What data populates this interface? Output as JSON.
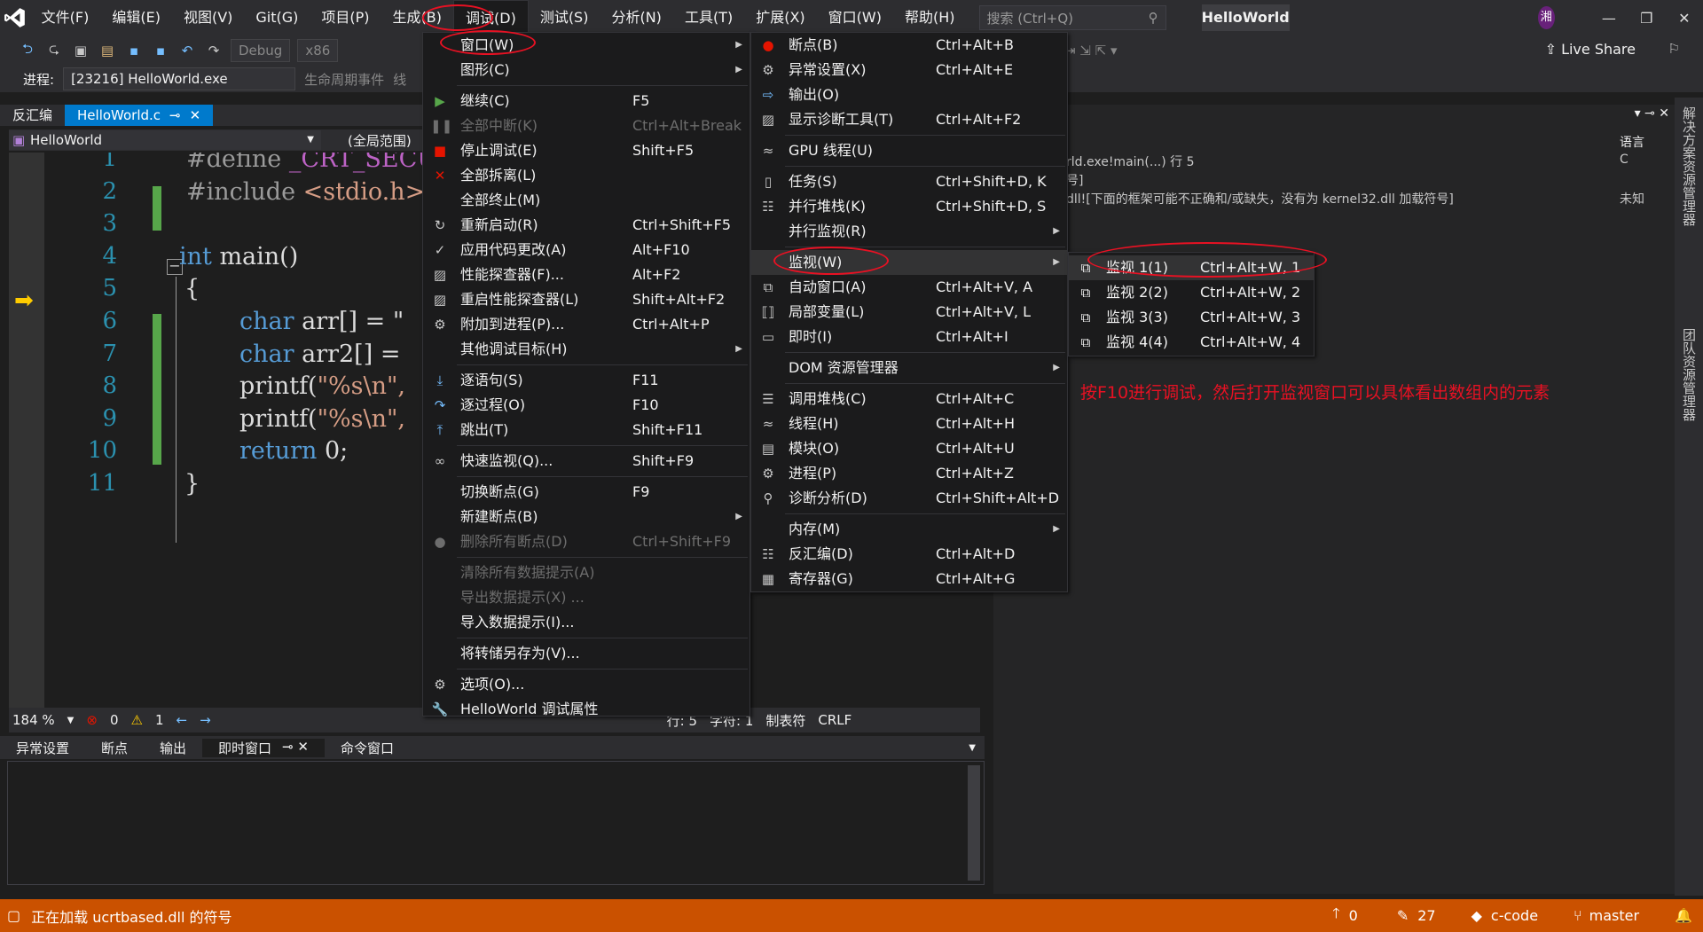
{
  "titlebar": {
    "menus": [
      "文件(F)",
      "编辑(E)",
      "视图(V)",
      "Git(G)",
      "项目(P)",
      "生成(B)",
      "调试(D)",
      "测试(S)",
      "分析(N)",
      "工具(T)",
      "扩展(X)",
      "窗口(W)",
      "帮助(H)"
    ],
    "search_placeholder": "搜索 (Ctrl+Q)",
    "app_title": "HelloWorld",
    "avatar": "湘"
  },
  "toolbar": {
    "config": "Debug",
    "platform": "x86",
    "live_share": "Live Share"
  },
  "procbar": {
    "label": "进程:",
    "process": "[23216] HelloWorld.exe",
    "lifecycle": "生命周期事件",
    "thread_trunc": "线"
  },
  "tabs": {
    "disasm": "反汇编",
    "file": "HelloWorld.c"
  },
  "navbar": {
    "project": "HelloWorld",
    "scope": "(全局范围)"
  },
  "editor": {
    "line_numbers": [
      "1",
      "2",
      "3",
      "4",
      "5",
      "6",
      "7",
      "8",
      "9",
      "10",
      "11"
    ],
    "lines": [
      {
        "a": "#define ",
        "b": "_CRT_SECUR"
      },
      {
        "a": "#include ",
        "b": "<stdio.h>"
      },
      {
        "a": "",
        "b": ""
      },
      {
        "a": "int",
        "b": " main()"
      },
      {
        "a": "{",
        "b": ""
      },
      {
        "a": "char",
        "b": " arr[] = \""
      },
      {
        "a": "char",
        "b": " arr2[] ="
      },
      {
        "a": "printf(",
        "b": "\"%s\\n\","
      },
      {
        "a": "printf(",
        "b": "\"%s\\n\","
      },
      {
        "a": "return",
        "b": " 0;"
      },
      {
        "a": "}",
        "b": ""
      }
    ]
  },
  "edstatus": {
    "zoom": "184 %",
    "errors": "0",
    "warnings": "1",
    "line": "行: 5",
    "col": "字符: 1",
    "tab": "制表符",
    "eol": "CRLF"
  },
  "bottom_tabs": [
    "异常设置",
    "断点",
    "输出",
    "即时窗口",
    "命令窗口"
  ],
  "right_panel": {
    "header_lang": "语言",
    "rows": [
      {
        "text": "rld.exe!main(...) 行 5",
        "lang": "C"
      },
      {
        "text": "号]",
        "lang": ""
      },
      {
        "text": "dll![下面的框架可能不正确和/或缺失，没有为 kernel32.dll 加载符号]",
        "lang": "未知"
      }
    ],
    "side_tabs": [
      "解决方案资源管理器",
      "团队资源管理器"
    ]
  },
  "debug_menu": [
    {
      "label": "窗口(W)",
      "shortcut": "",
      "sub": true,
      "icon": ""
    },
    {
      "label": "图形(C)",
      "shortcut": "",
      "sub": true,
      "icon": ""
    },
    {
      "sep": true
    },
    {
      "label": "继续(C)",
      "shortcut": "F5",
      "icon": "play-icon"
    },
    {
      "label": "全部中断(K)",
      "shortcut": "Ctrl+Alt+Break",
      "dis": true,
      "icon": "pause-icon"
    },
    {
      "label": "停止调试(E)",
      "shortcut": "Shift+F5",
      "icon": "stop-icon"
    },
    {
      "label": "全部拆离(L)",
      "shortcut": "",
      "icon": "x-icon"
    },
    {
      "label": "全部终止(M)",
      "shortcut": "",
      "icon": ""
    },
    {
      "label": "重新启动(R)",
      "shortcut": "Ctrl+Shift+F5",
      "icon": "restart-icon"
    },
    {
      "label": "应用代码更改(A)",
      "shortcut": "Alt+F10",
      "icon": "apply-icon"
    },
    {
      "label": "性能探查器(F)...",
      "shortcut": "Alt+F2",
      "icon": "profiler-icon"
    },
    {
      "label": "重启性能探查器(L)",
      "shortcut": "Shift+Alt+F2",
      "icon": "profiler-icon"
    },
    {
      "label": "附加到进程(P)...",
      "shortcut": "Ctrl+Alt+P",
      "icon": "gear-icon"
    },
    {
      "label": "其他调试目标(H)",
      "shortcut": "",
      "sub": true,
      "icon": ""
    },
    {
      "sep": true
    },
    {
      "label": "逐语句(S)",
      "shortcut": "F11",
      "icon": "step-into-icon"
    },
    {
      "label": "逐过程(O)",
      "shortcut": "F10",
      "icon": "step-over-icon"
    },
    {
      "label": "跳出(T)",
      "shortcut": "Shift+F11",
      "icon": "step-out-icon"
    },
    {
      "sep": true
    },
    {
      "label": "快速监视(Q)...",
      "shortcut": "Shift+F9",
      "icon": "glasses-icon"
    },
    {
      "sep": true
    },
    {
      "label": "切换断点(G)",
      "shortcut": "F9",
      "icon": ""
    },
    {
      "label": "新建断点(B)",
      "shortcut": "",
      "sub": true,
      "icon": ""
    },
    {
      "label": "删除所有断点(D)",
      "shortcut": "Ctrl+Shift+F9",
      "dis": true,
      "icon": "bp-icon"
    },
    {
      "sep": true
    },
    {
      "label": "清除所有数据提示(A)",
      "shortcut": "",
      "dis": true,
      "icon": ""
    },
    {
      "label": "导出数据提示(X) ...",
      "shortcut": "",
      "dis": true,
      "icon": ""
    },
    {
      "label": "导入数据提示(I)...",
      "shortcut": "",
      "icon": ""
    },
    {
      "sep": true
    },
    {
      "label": "将转储另存为(V)...",
      "shortcut": "",
      "icon": ""
    },
    {
      "sep": true
    },
    {
      "label": "选项(O)...",
      "shortcut": "",
      "icon": "gear-icon"
    },
    {
      "label": "HelloWorld 调试属性",
      "shortcut": "",
      "icon": "wrench-icon"
    }
  ],
  "window_menu": [
    {
      "label": "断点(B)",
      "shortcut": "Ctrl+Alt+B",
      "icon": "breakpoint-icon"
    },
    {
      "label": "异常设置(X)",
      "shortcut": "Ctrl+Alt+E",
      "icon": "exception-icon"
    },
    {
      "label": "输出(O)",
      "shortcut": "",
      "icon": "output-icon"
    },
    {
      "label": "显示诊断工具(T)",
      "shortcut": "Ctrl+Alt+F2",
      "icon": "diag-icon"
    },
    {
      "sep": true
    },
    {
      "label": "GPU 线程(U)",
      "shortcut": "",
      "icon": "thread-icon"
    },
    {
      "sep": true
    },
    {
      "label": "任务(S)",
      "shortcut": "Ctrl+Shift+D, K",
      "icon": "task-icon"
    },
    {
      "label": "并行堆栈(K)",
      "shortcut": "Ctrl+Shift+D, S",
      "icon": "stack-icon"
    },
    {
      "label": "并行监视(R)",
      "shortcut": "",
      "sub": true,
      "icon": ""
    },
    {
      "sep": true
    },
    {
      "label": "监视(W)",
      "shortcut": "",
      "sub": true,
      "icon": "",
      "hl": true
    },
    {
      "label": "自动窗口(A)",
      "shortcut": "Ctrl+Alt+V, A",
      "icon": "auto-icon"
    },
    {
      "label": "局部变量(L)",
      "shortcut": "Ctrl+Alt+V, L",
      "icon": "locals-icon"
    },
    {
      "label": "即时(I)",
      "shortcut": "Ctrl+Alt+I",
      "icon": "immediate-icon"
    },
    {
      "sep": true
    },
    {
      "label": "DOM 资源管理器",
      "shortcut": "",
      "sub": true,
      "icon": ""
    },
    {
      "sep": true
    },
    {
      "label": "调用堆栈(C)",
      "shortcut": "Ctrl+Alt+C",
      "icon": "callstack-icon"
    },
    {
      "label": "线程(H)",
      "shortcut": "Ctrl+Alt+H",
      "icon": "thread-icon"
    },
    {
      "label": "模块(O)",
      "shortcut": "Ctrl+Alt+U",
      "icon": "module-icon"
    },
    {
      "label": "进程(P)",
      "shortcut": "Ctrl+Alt+Z",
      "icon": "process-icon"
    },
    {
      "label": "诊断分析(D)",
      "shortcut": "Ctrl+Shift+Alt+D",
      "icon": "analysis-icon"
    },
    {
      "sep": true
    },
    {
      "label": "内存(M)",
      "shortcut": "",
      "sub": true,
      "icon": ""
    },
    {
      "label": "反汇编(D)",
      "shortcut": "Ctrl+Alt+D",
      "icon": "disasm-icon"
    },
    {
      "label": "寄存器(G)",
      "shortcut": "Ctrl+Alt+G",
      "icon": "register-icon"
    }
  ],
  "watch_menu": [
    {
      "label": "监视 1(1)",
      "shortcut": "Ctrl+Alt+W, 1"
    },
    {
      "label": "监视 2(2)",
      "shortcut": "Ctrl+Alt+W, 2"
    },
    {
      "label": "监视 3(3)",
      "shortcut": "Ctrl+Alt+W, 3"
    },
    {
      "label": "监视 4(4)",
      "shortcut": "Ctrl+Alt+W, 4"
    }
  ],
  "annotation": "按F10进行调试，然后打开监视窗口可以具体看出数组内的元素",
  "statusbar": {
    "message": "正在加载 ucrtbased.dll 的符号",
    "up": "0",
    "edits": "27",
    "repo": "c-code",
    "branch": "master"
  },
  "colors": {
    "accent": "#007acc",
    "status": "#ca5100",
    "annotation": "#e81123"
  }
}
